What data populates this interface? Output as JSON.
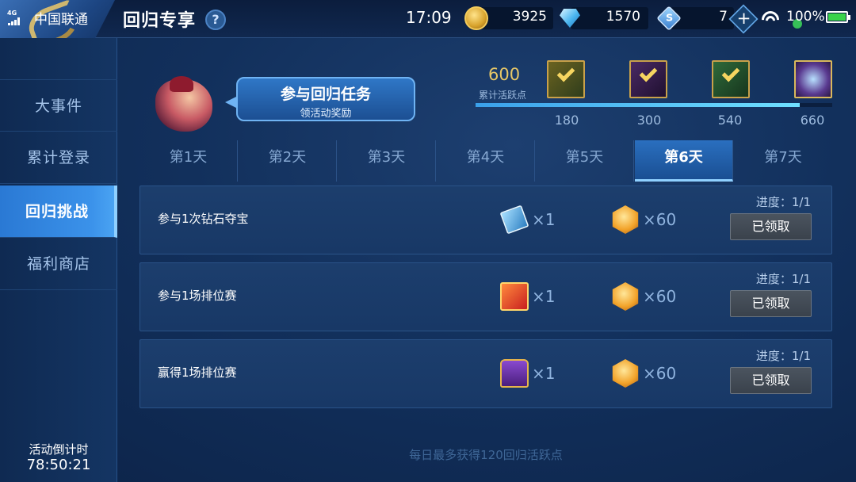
{
  "status_bar": {
    "network": "4G",
    "carrier": "中国联通",
    "time": "17:09",
    "battery_percent": "100%"
  },
  "header": {
    "title": "回归专享",
    "help_icon": "question-circle-icon",
    "help_symbol": "?"
  },
  "currencies": {
    "gold": "3925",
    "diamonds": "1570",
    "vouchers": "7",
    "voucher_symbol": "S",
    "add_symbol": "+"
  },
  "sidebar": {
    "items": [
      {
        "label": "大事件"
      },
      {
        "label": "累计登录"
      },
      {
        "label": "回归挑战"
      },
      {
        "label": "福利商店"
      }
    ],
    "active_index": 2,
    "countdown_label": "活动倒计时",
    "countdown_value": "78:50:21"
  },
  "hero": {
    "bubble_title": "参与回归任务",
    "bubble_subtitle": "领活动奖励"
  },
  "activity_progress": {
    "points": "600",
    "points_label": "累计活跃点",
    "max": 660,
    "milestones": [
      {
        "value": "180",
        "claimed": true
      },
      {
        "value": "300",
        "claimed": true
      },
      {
        "value": "540",
        "claimed": true
      },
      {
        "value": "660",
        "claimed": false
      }
    ]
  },
  "tabs": {
    "items": [
      {
        "label": "第1天"
      },
      {
        "label": "第2天"
      },
      {
        "label": "第3天"
      },
      {
        "label": "第4天"
      },
      {
        "label": "第5天"
      },
      {
        "label": "第6天"
      },
      {
        "label": "第7天"
      }
    ],
    "active_index": 5
  },
  "tasks": [
    {
      "name": "参与1次钻石夺宝",
      "reward_item": {
        "icon": "gold-card-icon",
        "qty": "×1"
      },
      "reward_points": {
        "icon": "activity-gem-icon",
        "qty": "×60"
      },
      "progress": "进度：1/1",
      "button": "已领取"
    },
    {
      "name": "参与1场排位赛",
      "reward_item": {
        "icon": "gift-box-icon",
        "qty": "×1"
      },
      "reward_points": {
        "icon": "activity-gem-icon",
        "qty": "×60"
      },
      "progress": "进度：1/1",
      "button": "已领取"
    },
    {
      "name": "赢得1场排位赛",
      "reward_item": {
        "icon": "treasure-chest-icon",
        "qty": "×1"
      },
      "reward_points": {
        "icon": "activity-gem-icon",
        "qty": "×60"
      },
      "progress": "进度：1/1",
      "button": "已领取"
    }
  ],
  "footer_note": "每日最多获得120回归活跃点",
  "colors": {
    "accent_gold": "#e9c867",
    "active_blue": "#3b92ea",
    "progress_fill": "#6fe0ff"
  }
}
